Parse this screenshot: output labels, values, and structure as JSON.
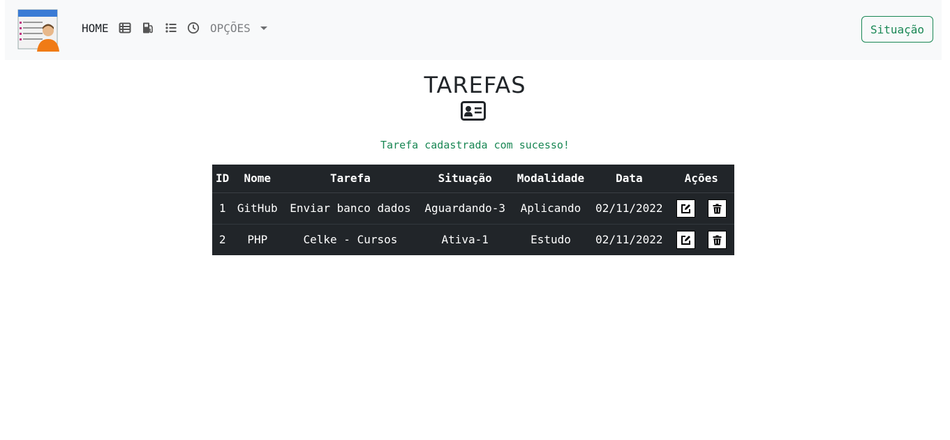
{
  "navbar": {
    "home_label": "HOME",
    "icons": [
      "table-icon",
      "gas-pump-icon",
      "list-icon",
      "clock-icon"
    ],
    "opcoes_label": "OPÇÕES",
    "situacao_button": "Situação",
    "accent_color": "#198754"
  },
  "page": {
    "title": "TAREFAS",
    "title_icon": "id-card-icon",
    "success_message": "Tarefa cadastrada com sucesso!"
  },
  "table": {
    "headers": [
      "ID",
      "Nome",
      "Tarefa",
      "Situação",
      "Modalidade",
      "Data",
      "Ações"
    ],
    "rows": [
      {
        "id": "1",
        "nome": "GitHub",
        "tarefa": "Enviar banco dados",
        "situacao": "Aguardando-3",
        "modalidade": "Aplicando",
        "data": "02/11/2022"
      },
      {
        "id": "2",
        "nome": "PHP",
        "tarefa": "Celke - Cursos",
        "situacao": "Ativa-1",
        "modalidade": "Estudo",
        "data": "02/11/2022"
      }
    ],
    "row_actions": [
      "edit-icon",
      "trash-icon"
    ]
  }
}
